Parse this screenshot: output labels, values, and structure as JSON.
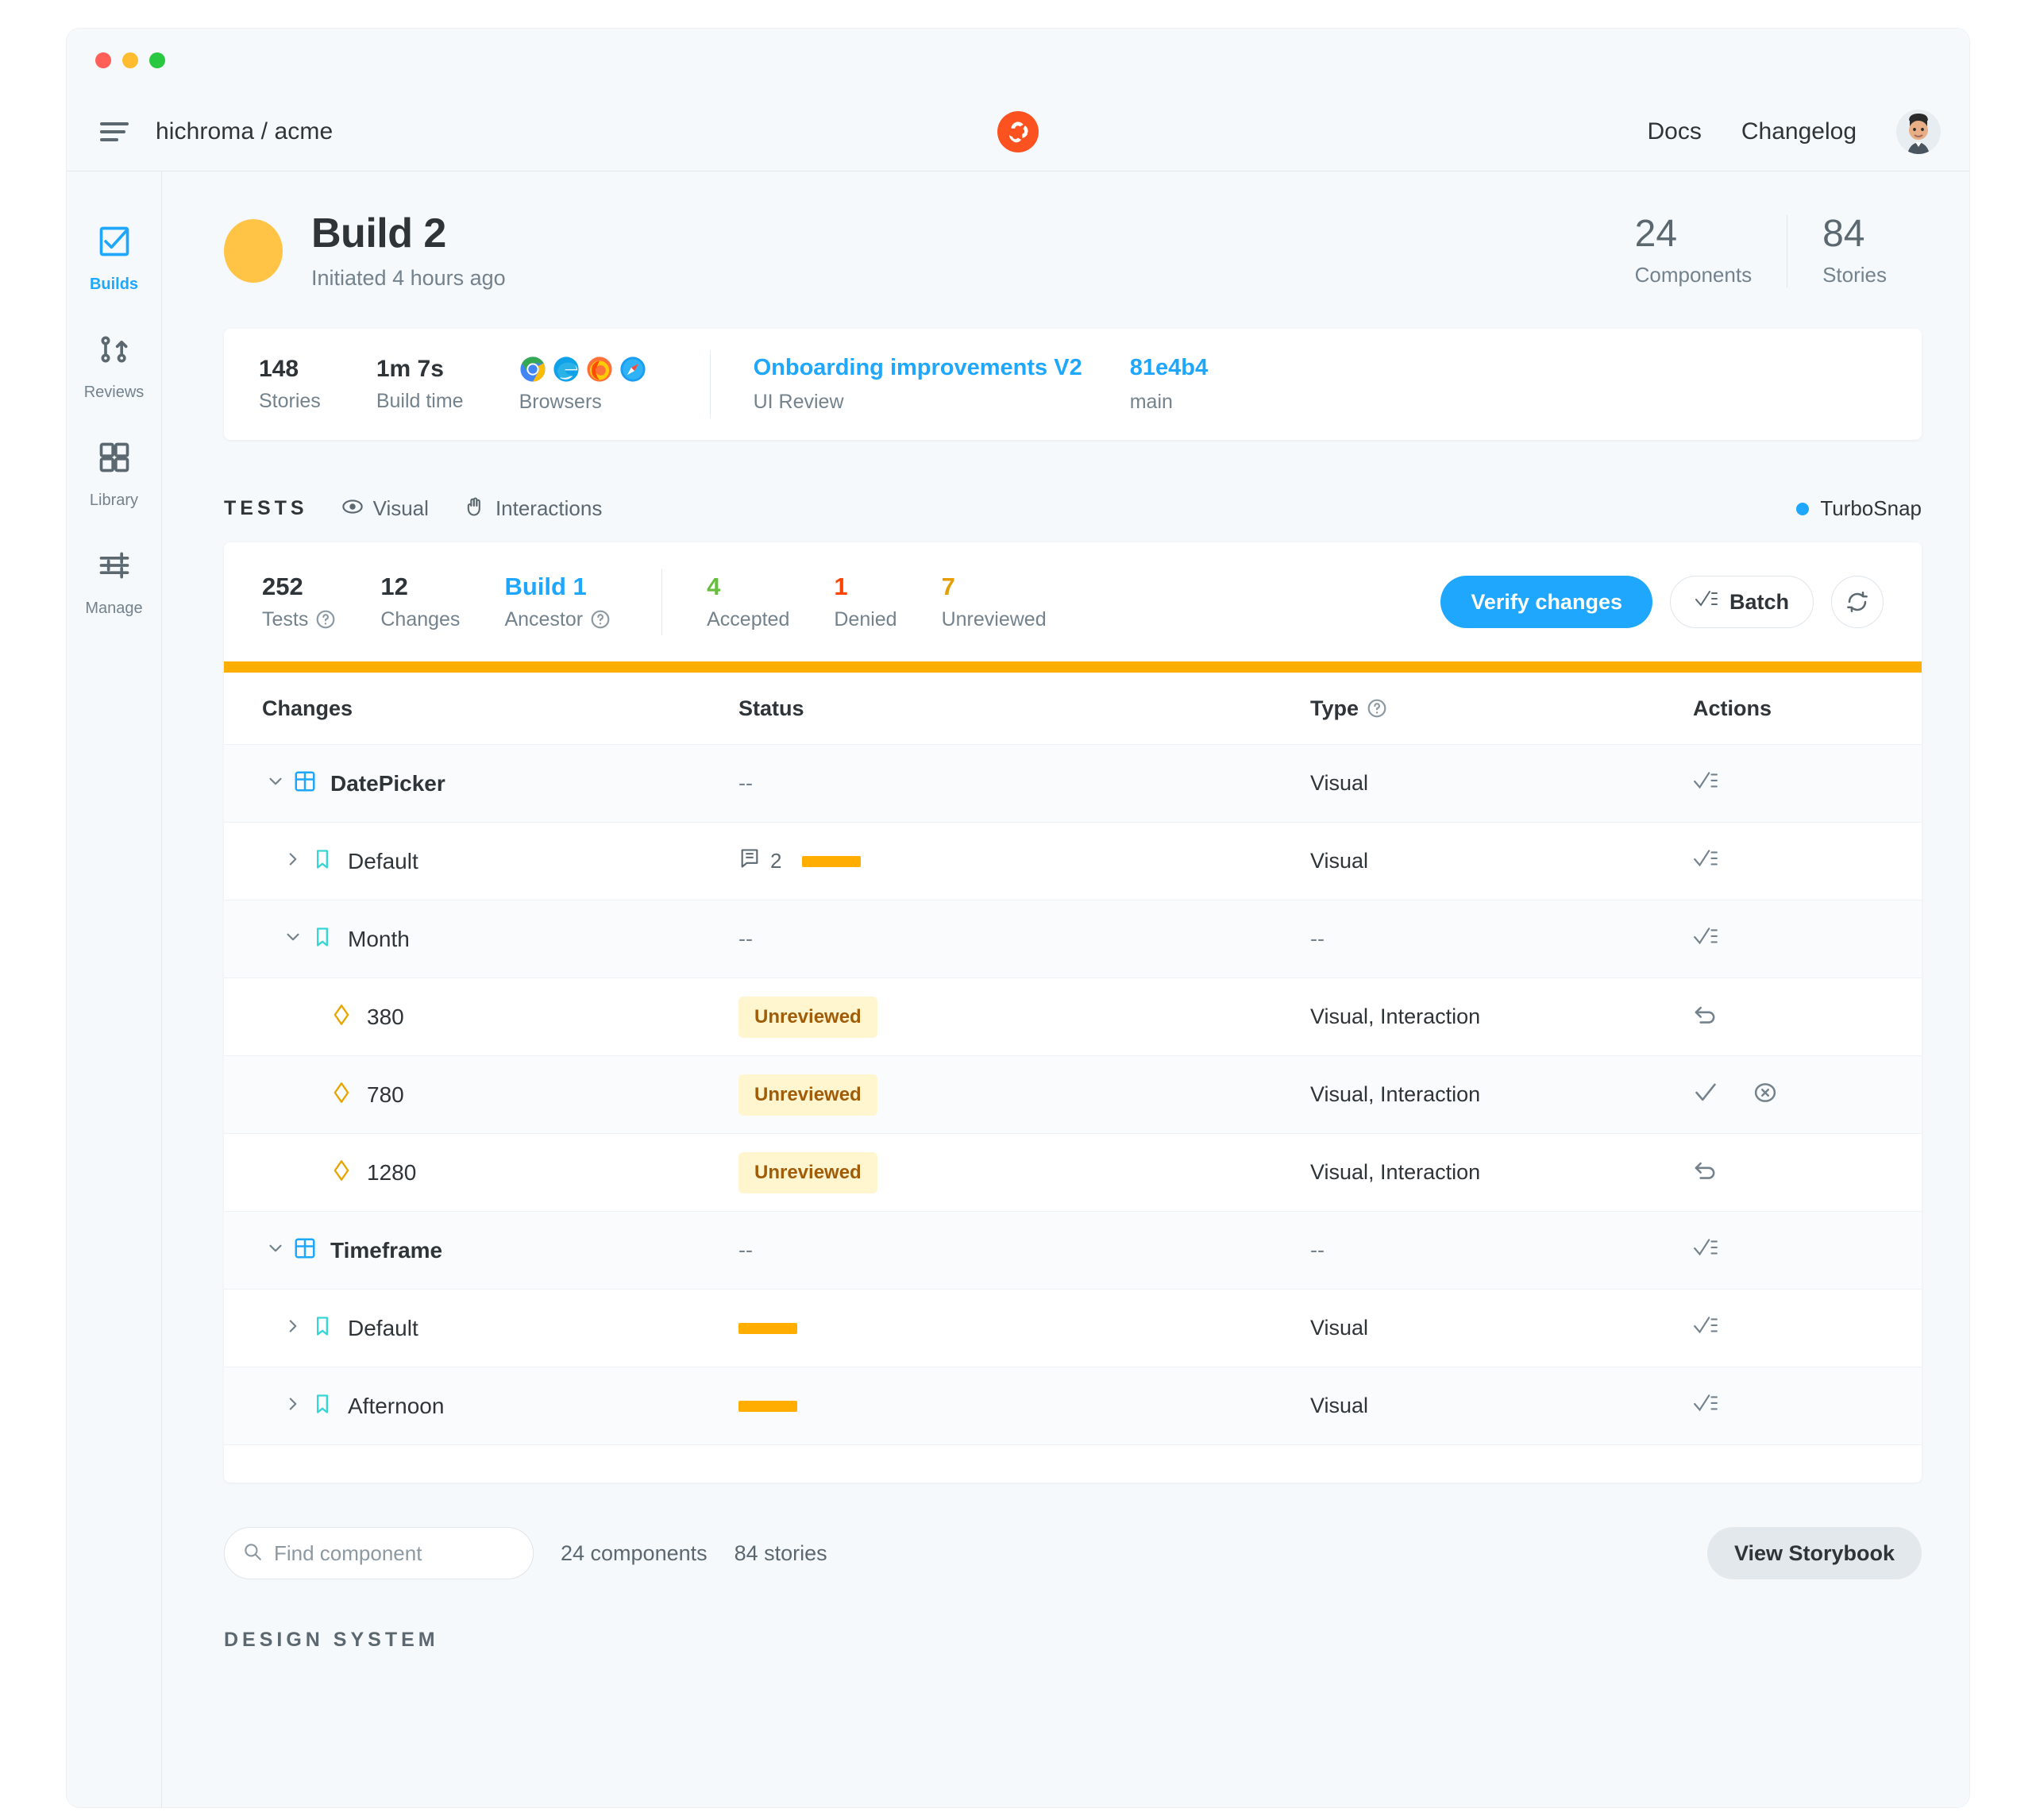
{
  "window": {
    "traffic_lights": [
      "close",
      "minimize",
      "maximize"
    ]
  },
  "header": {
    "menu_icon": "hamburger-icon",
    "breadcrumb": "hichroma / acme",
    "logo": "chromatic-logo",
    "links": [
      {
        "label": "Docs"
      },
      {
        "label": "Changelog"
      }
    ],
    "avatar": "user-avatar"
  },
  "sidebar": {
    "items": [
      {
        "label": "Builds",
        "icon": "checkbox-icon",
        "active": true
      },
      {
        "label": "Reviews",
        "icon": "pull-request-icon",
        "active": false
      },
      {
        "label": "Library",
        "icon": "grid-icon",
        "active": false
      },
      {
        "label": "Manage",
        "icon": "sliders-icon",
        "active": false
      }
    ]
  },
  "hero": {
    "status_color": "#FFC445",
    "title": "Build 2",
    "subtitle": "Initiated 4 hours ago",
    "stats": [
      {
        "value": "24",
        "label": "Components"
      },
      {
        "value": "84",
        "label": "Stories"
      }
    ]
  },
  "meta_card": {
    "stats": [
      {
        "value": "148",
        "label": "Stories"
      },
      {
        "value": "1m 7s",
        "label": "Build time"
      }
    ],
    "browsers_label": "Browsers",
    "browsers": [
      {
        "name": "chrome-icon",
        "color": "#4285F4"
      },
      {
        "name": "edge-icon",
        "color": "#0FA2E9"
      },
      {
        "name": "firefox-icon",
        "color": "#FF7139"
      },
      {
        "name": "safari-icon",
        "color": "#1B9DF3"
      }
    ],
    "pr_title": "Onboarding improvements V2",
    "pr_sub": "UI Review",
    "commit": "81e4b4",
    "branch": "main"
  },
  "tests_section": {
    "title": "TESTS",
    "tabs": [
      {
        "label": "Visual",
        "icon": "eye-icon",
        "selected": true
      },
      {
        "label": "Interactions",
        "icon": "pointer-icon",
        "selected": false
      }
    ],
    "turbosnap": {
      "label": "TurboSnap",
      "color": "#1EA7FD"
    },
    "summary": [
      {
        "value": "252",
        "label": "Tests",
        "help": true,
        "color": "default"
      },
      {
        "value": "12",
        "label": "Changes",
        "help": false,
        "color": "default"
      },
      {
        "value": "Build 1",
        "label": "Ancestor",
        "help": true,
        "color": "blue"
      }
    ],
    "review_summary": [
      {
        "value": "4",
        "label": "Accepted",
        "color": "green"
      },
      {
        "value": "1",
        "label": "Denied",
        "color": "red"
      },
      {
        "value": "7",
        "label": "Unreviewed",
        "color": "orange"
      }
    ],
    "buttons": {
      "verify": "Verify changes",
      "batch": "Batch",
      "refresh_icon": "refresh-icon"
    },
    "progress_color": "#FFAE00"
  },
  "table": {
    "columns": [
      {
        "label": "Changes",
        "help": false
      },
      {
        "label": "Status",
        "help": false
      },
      {
        "label": "Type",
        "help": true
      },
      {
        "label": "Actions",
        "help": false
      }
    ],
    "rows": [
      {
        "kind": "component",
        "indent": 0,
        "expanded": true,
        "chevron": "chevron-down-icon",
        "icon": "component-icon",
        "name": "DatePicker",
        "bold": true,
        "status_text": "--",
        "status_type": "text",
        "type": "Visual",
        "actions": [
          "batch-accept-icon"
        ],
        "alt": true
      },
      {
        "kind": "story",
        "indent": 1,
        "expanded": false,
        "chevron": "chevron-right-icon",
        "icon": "story-icon",
        "name": "Default",
        "bold": false,
        "status_text": "",
        "status_type": "bar",
        "comments": "2",
        "type": "Visual",
        "actions": [
          "batch-accept-icon"
        ],
        "alt": false
      },
      {
        "kind": "story",
        "indent": 1,
        "expanded": true,
        "chevron": "chevron-down-icon",
        "icon": "story-icon",
        "name": "Month",
        "bold": false,
        "status_text": "--",
        "status_type": "text",
        "type": "--",
        "actions": [
          "batch-accept-icon"
        ],
        "alt": true
      },
      {
        "kind": "viewport",
        "indent": 2,
        "expanded": false,
        "chevron": "",
        "icon": "viewport-icon",
        "name": "380",
        "bold": false,
        "status_text": "Unreviewed",
        "status_type": "badge",
        "type": "Visual, Interaction",
        "actions": [
          "undo-icon"
        ],
        "alt": false
      },
      {
        "kind": "viewport",
        "indent": 2,
        "expanded": false,
        "chevron": "",
        "icon": "viewport-icon",
        "name": "780",
        "bold": false,
        "status_text": "Unreviewed",
        "status_type": "badge",
        "type": "Visual, Interaction",
        "actions": [
          "accept-check-icon",
          "deny-circle-x-icon"
        ],
        "alt": true
      },
      {
        "kind": "viewport",
        "indent": 2,
        "expanded": false,
        "chevron": "",
        "icon": "viewport-icon",
        "name": "1280",
        "bold": false,
        "status_text": "Unreviewed",
        "status_type": "badge",
        "type": "Visual, Interaction",
        "actions": [
          "undo-icon"
        ],
        "alt": false
      },
      {
        "kind": "component",
        "indent": 0,
        "expanded": true,
        "chevron": "chevron-down-icon",
        "icon": "component-icon",
        "name": "Timeframe",
        "bold": true,
        "status_text": "--",
        "status_type": "text",
        "type": "--",
        "actions": [
          "batch-accept-icon"
        ],
        "alt": true
      },
      {
        "kind": "story",
        "indent": 1,
        "expanded": false,
        "chevron": "chevron-right-icon",
        "icon": "story-icon",
        "name": "Default",
        "bold": false,
        "status_text": "",
        "status_type": "bar",
        "type": "Visual",
        "actions": [
          "batch-accept-icon"
        ],
        "alt": false
      },
      {
        "kind": "story",
        "indent": 1,
        "expanded": false,
        "chevron": "chevron-right-icon",
        "icon": "story-icon",
        "name": "Afternoon",
        "bold": false,
        "status_text": "",
        "status_type": "bar",
        "type": "Visual",
        "actions": [
          "batch-accept-icon"
        ],
        "alt": true
      }
    ]
  },
  "bottom": {
    "search_placeholder": "Find component",
    "search_value": "",
    "components_count": "24 components",
    "stories_count": "84 stories",
    "view_storybook": "View Storybook",
    "design_system_label": "DESIGN SYSTEM"
  }
}
